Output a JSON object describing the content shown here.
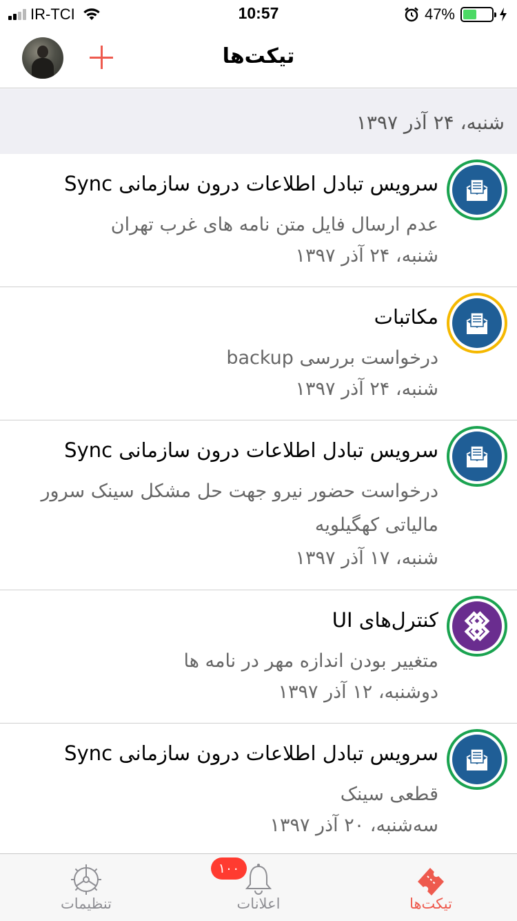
{
  "status_bar": {
    "carrier": "IR-TCI",
    "time": "10:57",
    "battery_percent": "47%",
    "battery_level": 0.47,
    "signal_bars": 2
  },
  "nav": {
    "title": "تیکت‌ها"
  },
  "section": {
    "date": "شنبه، ۲۴ آذر ۱۳۹۷"
  },
  "tickets": [
    {
      "title": "سرویس تبادل اطلاعات درون سازمانی Sync",
      "description": "عدم ارسال فایل متن نامه های غرب تهران",
      "date": "شنبه، ۲۴ آذر ۱۳۹۷",
      "ring_color": "#1aa350",
      "icon": "mail-document-icon",
      "icon_bg": "#1f5e96"
    },
    {
      "title": "مکاتبات",
      "description": "درخواست بررسی backup",
      "date": "شنبه، ۲۴ آذر ۱۳۹۷",
      "ring_color": "#f5b800",
      "icon": "mail-document-icon",
      "icon_bg": "#1f5e96"
    },
    {
      "title": "سرویس تبادل اطلاعات درون سازمانی Sync",
      "description": "درخواست حضور نیرو جهت حل مشکل سینک سرور مالیاتی کهگیلویه",
      "date": "شنبه، ۱۷ آذر ۱۳۹۷",
      "ring_color": "#1aa350",
      "icon": "mail-document-icon",
      "icon_bg": "#1f5e96"
    },
    {
      "title": "کنترل‌های UI",
      "description": "متغییر بودن اندازه مهر در نامه ها",
      "date": "دوشنبه، ۱۲ آذر ۱۳۹۷",
      "ring_color": "#1aa350",
      "icon": "puzzle-knot-icon",
      "icon_bg": "#6a2d8f"
    },
    {
      "title": "سرویس تبادل اطلاعات درون سازمانی Sync",
      "description": "قطعی سینک",
      "date": "سه‌شنبه، ۲۰ آذر ۱۳۹۷",
      "ring_color": "#1aa350",
      "icon": "mail-document-icon",
      "icon_bg": "#1f5e96"
    }
  ],
  "tab_bar": {
    "settings_label": "تنظیمات",
    "notifications_label": "اعلانات",
    "notifications_badge": "۱۰۰",
    "tickets_label": "تیکت‌ها",
    "active_color": "#ee5a4e",
    "inactive_color": "#8e8e93"
  }
}
